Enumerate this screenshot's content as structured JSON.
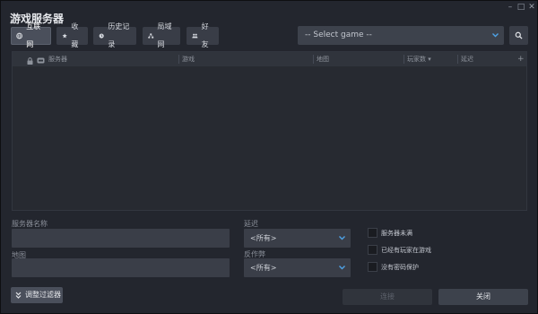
{
  "window": {
    "title": "游戏服务器",
    "controls": {
      "minimize": "–",
      "maximize": "□",
      "close": "✕"
    }
  },
  "tabs": [
    {
      "label": "互联网",
      "icon": "globe-icon",
      "active": true
    },
    {
      "label": "收藏",
      "icon": "star-icon",
      "active": false
    },
    {
      "label": "历史记录",
      "icon": "history-icon",
      "active": false
    },
    {
      "label": "局域网",
      "icon": "lan-icon",
      "active": false
    },
    {
      "label": "好友",
      "icon": "friends-icon",
      "active": false
    }
  ],
  "game_select": {
    "value": "-- Select game --"
  },
  "table": {
    "columns": {
      "lock_icon": "lock-icon",
      "secure_icon": "shield-icon",
      "server": "服务器",
      "game": "游戏",
      "map": "地图",
      "players": "玩家数 ▾",
      "latency": "延迟",
      "add": "+"
    },
    "rows": []
  },
  "filters": {
    "server_name_label": "服务器名称",
    "server_name_value": "",
    "map_label": "地图",
    "map_value": "",
    "latency_label": "延迟",
    "latency_value": "<所有>",
    "anticheat_label": "反作弊",
    "anticheat_value": "<所有>",
    "checkbox_not_full": "服务器未满",
    "checkbox_has_players": "已经有玩家在游戏",
    "checkbox_no_password": "没有密码保护"
  },
  "buttons": {
    "adjust_filters": "调整过滤器",
    "connect": "连接",
    "close": "关闭"
  },
  "colors": {
    "accent": "#4ea2e6",
    "background": "#23262e"
  }
}
